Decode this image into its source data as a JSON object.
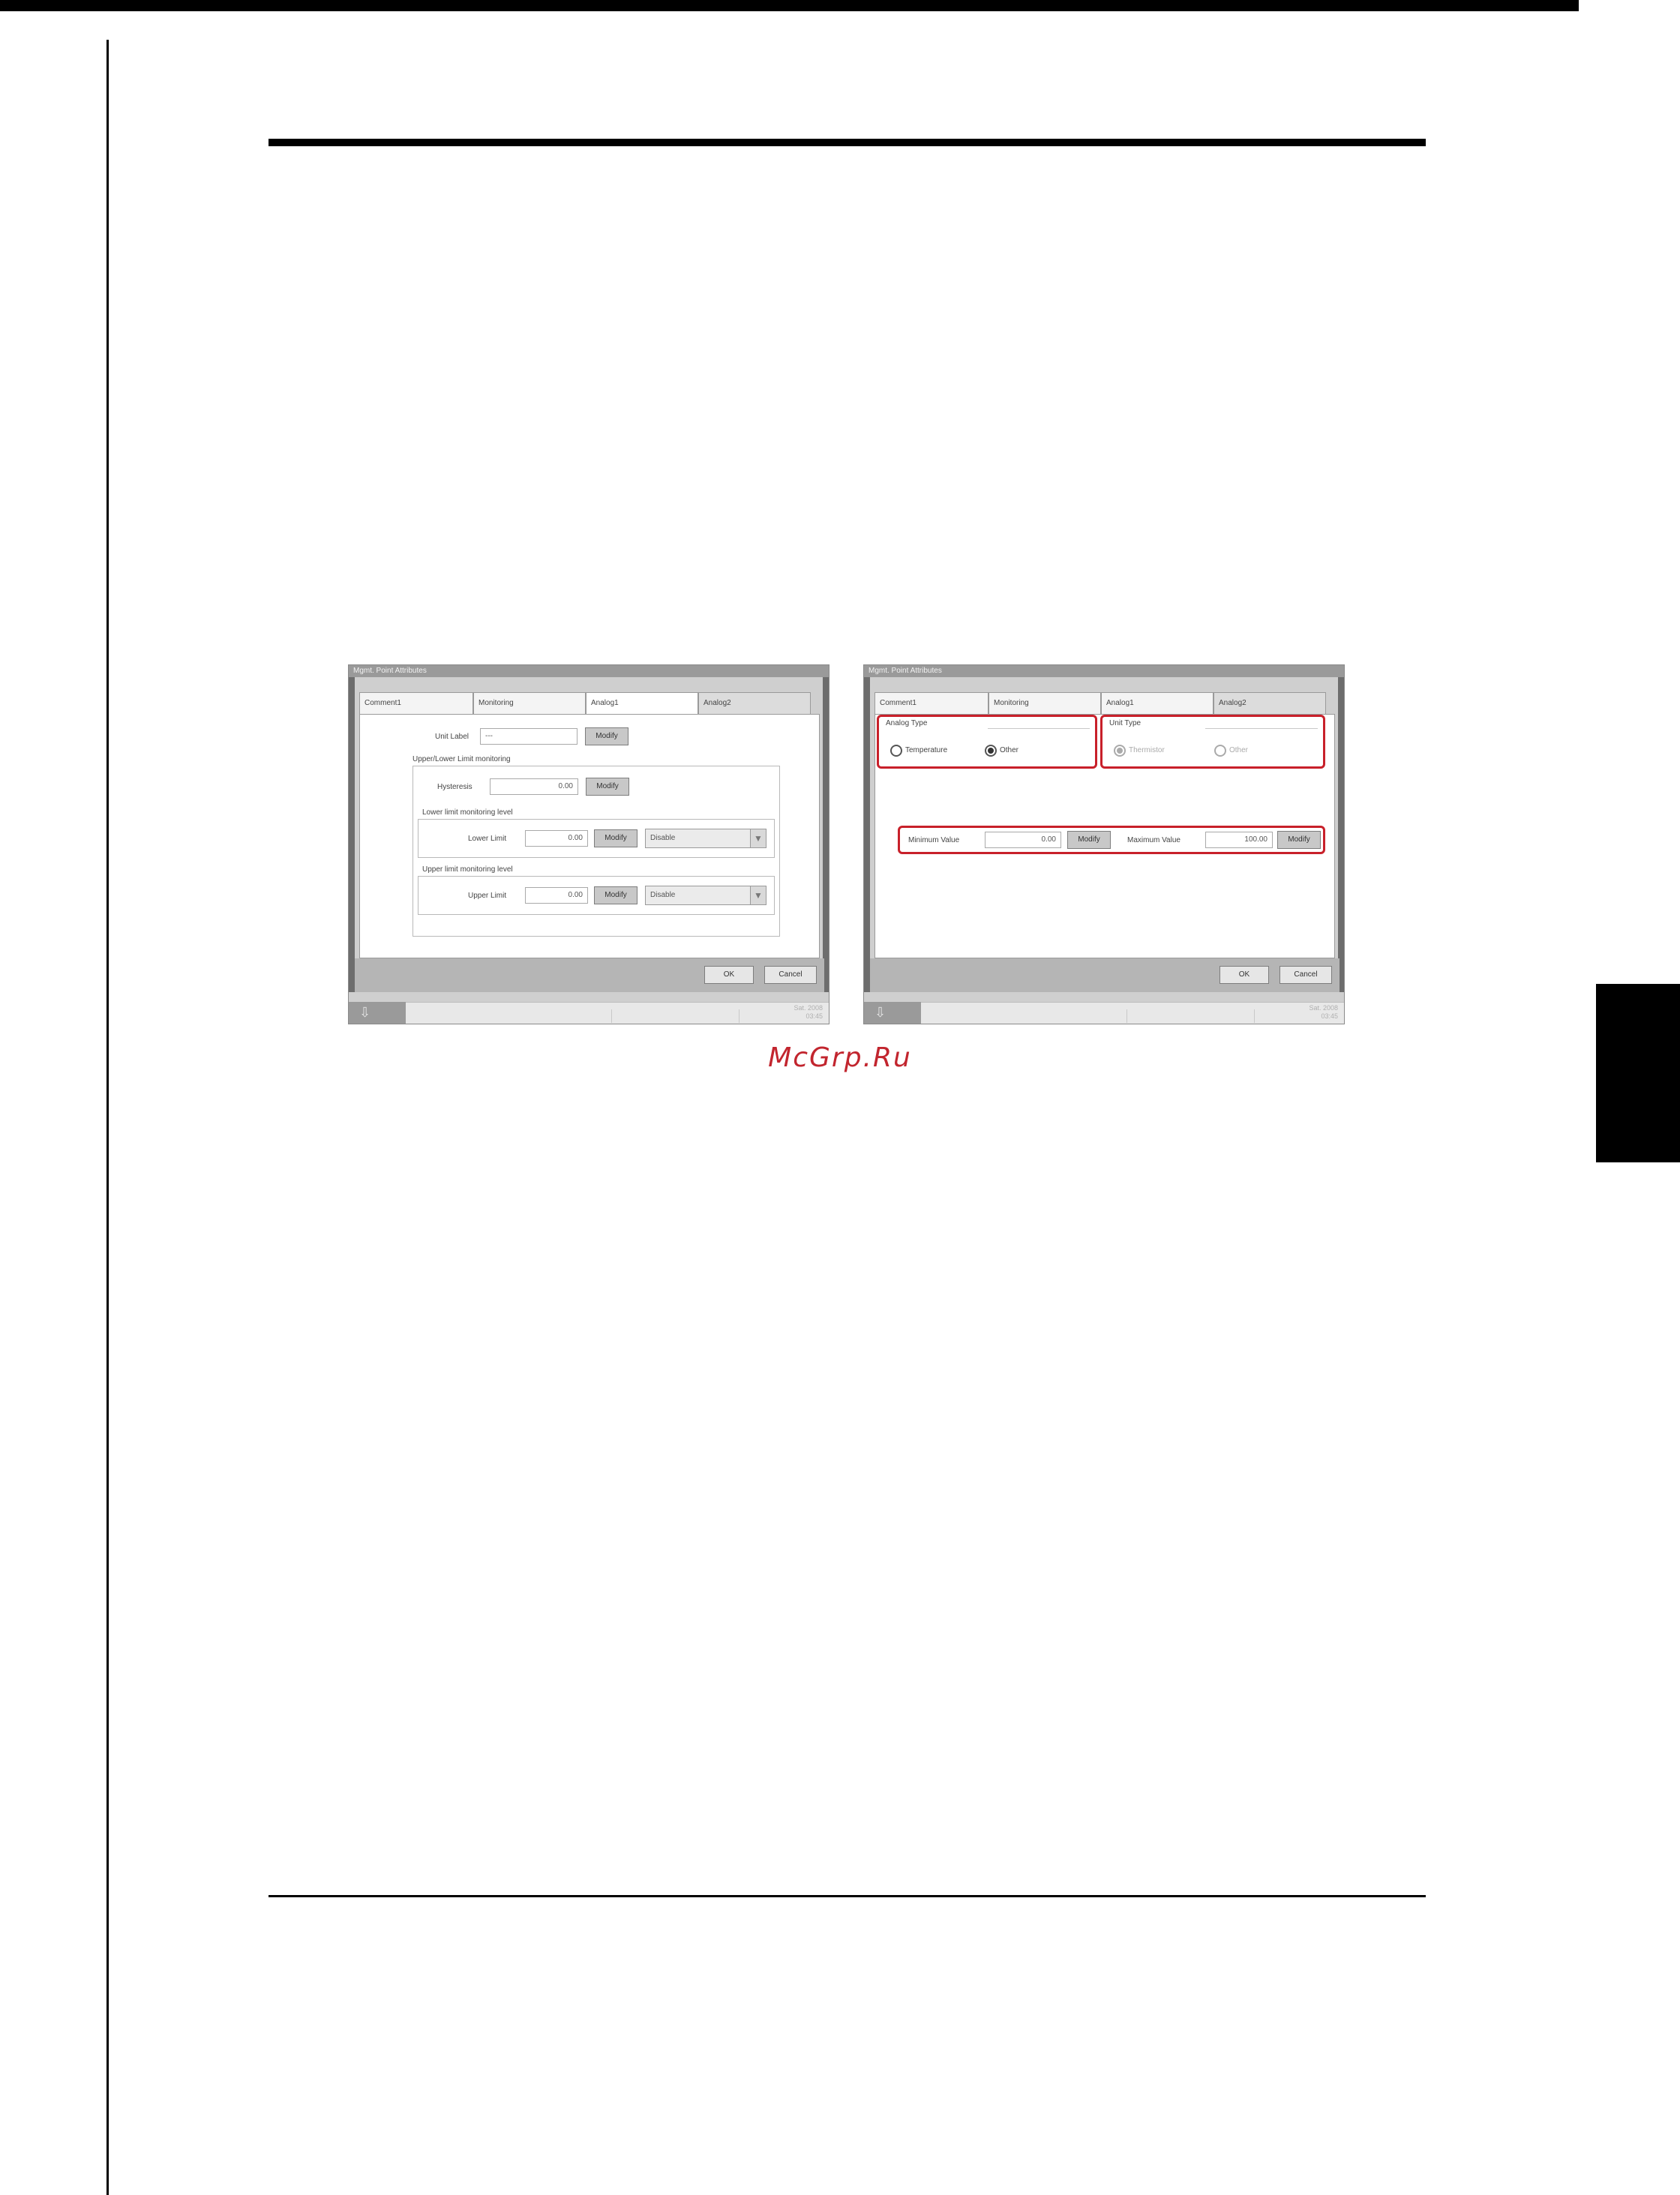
{
  "watermark": "McGrp.Ru",
  "left_screen": {
    "window_title": "Mgmt. Point Attributes",
    "tabs": [
      "Comment1",
      "Monitoring",
      "Analog1",
      "Analog2"
    ],
    "unit_label": {
      "label": "Unit Label",
      "value": "---",
      "button": "Modify"
    },
    "limit_group": "Upper/Lower Limit monitoring",
    "hysteresis": {
      "label": "Hysteresis",
      "value": "0.00",
      "button": "Modify"
    },
    "lower": {
      "group": "Lower limit monitoring level",
      "label": "Lower Limit",
      "value": "0.00",
      "button": "Modify",
      "select": "Disable"
    },
    "upper": {
      "group": "Upper limit monitoring level",
      "label": "Upper Limit",
      "value": "0.00",
      "button": "Modify",
      "select": "Disable"
    },
    "ok": "OK",
    "cancel": "Cancel",
    "status": {
      "date": "Sat. 2008",
      "time": "03:45"
    }
  },
  "right_screen": {
    "window_title": "Mgmt. Point Attributes",
    "tabs": [
      "Comment1",
      "Monitoring",
      "Analog1",
      "Analog2"
    ],
    "analog_type": {
      "title": "Analog Type",
      "opt1": "Temperature",
      "opt2": "Other",
      "selected": "Other"
    },
    "unit_type": {
      "title": "Unit Type",
      "opt1": "Thermistor",
      "opt2": "Other",
      "selected": "Thermistor"
    },
    "minimum": {
      "label": "Minimum Value",
      "value": "0.00",
      "button": "Modify"
    },
    "maximum": {
      "label": "Maximum Value",
      "value": "100.00",
      "button": "Modify"
    },
    "ok": "OK",
    "cancel": "Cancel",
    "status": {
      "date": "Sat. 2008",
      "time": "03:45"
    }
  },
  "colors": {
    "highlight": "#c8202a",
    "watermark": "#c2252e"
  }
}
